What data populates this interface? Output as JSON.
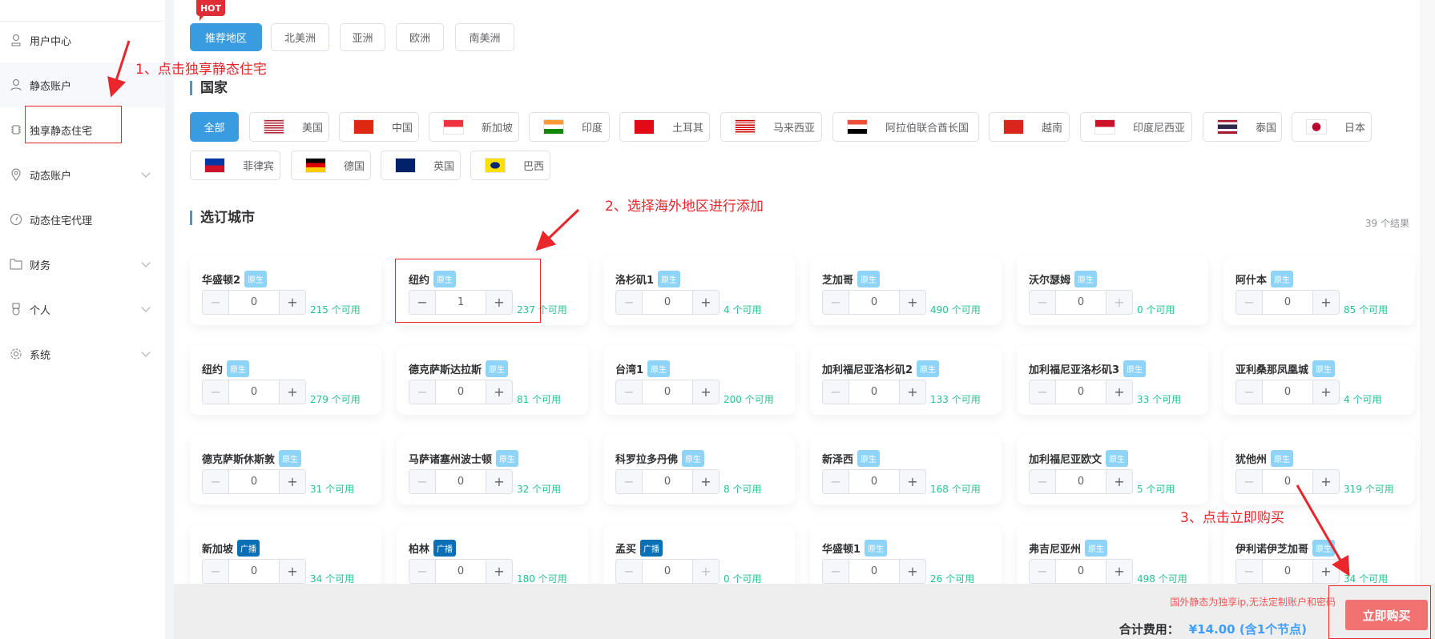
{
  "sidebar": {
    "items": [
      {
        "label": "用户中心",
        "icon": "user-center-icon"
      },
      {
        "label": "静态账户",
        "icon": "user-icon"
      },
      {
        "label": "独享静态住宅",
        "icon": "chip-icon"
      },
      {
        "label": "动态账户",
        "icon": "location-icon",
        "expandable": true
      },
      {
        "label": "动态住宅代理",
        "icon": "gauge-icon"
      },
      {
        "label": "财务",
        "icon": "folder-icon",
        "expandable": true
      },
      {
        "label": "个人",
        "icon": "badge-icon",
        "expandable": true
      },
      {
        "label": "系统",
        "icon": "gear-icon",
        "expandable": true
      }
    ]
  },
  "regions": {
    "hot_label": "HOT",
    "items": [
      "推荐地区",
      "北美洲",
      "亚洲",
      "欧洲",
      "南美洲"
    ],
    "selected": "推荐地区"
  },
  "countries": {
    "heading": "国家",
    "items": [
      {
        "label": "全部"
      },
      {
        "label": "美国",
        "flag": "us"
      },
      {
        "label": "中国",
        "flag": "cn"
      },
      {
        "label": "新加坡",
        "flag": "sg"
      },
      {
        "label": "印度",
        "flag": "in"
      },
      {
        "label": "土耳其",
        "flag": "tr"
      },
      {
        "label": "马来西亚",
        "flag": "my"
      },
      {
        "label": "阿拉伯联合酋长国",
        "flag": "eg"
      },
      {
        "label": "越南",
        "flag": "vn"
      },
      {
        "label": "印度尼西亚",
        "flag": "id"
      },
      {
        "label": "泰国",
        "flag": "th"
      },
      {
        "label": "日本",
        "flag": "jp"
      },
      {
        "label": "菲律宾",
        "flag": "ph"
      },
      {
        "label": "德国",
        "flag": "de"
      },
      {
        "label": "英国",
        "flag": "gb"
      },
      {
        "label": "巴西",
        "flag": "br"
      }
    ],
    "selected": "全部"
  },
  "cities": {
    "heading": "选订城市",
    "result_count": "39 个结果",
    "items": [
      {
        "name": "华盛顿2",
        "type": "原生",
        "qty": "0",
        "available": "215 个可用"
      },
      {
        "name": "纽约",
        "type": "原生",
        "qty": "1",
        "available": "237 个可用"
      },
      {
        "name": "洛杉矶1",
        "type": "原生",
        "qty": "0",
        "available": "4 个可用"
      },
      {
        "name": "芝加哥",
        "type": "原生",
        "qty": "0",
        "available": "490 个可用"
      },
      {
        "name": "沃尔瑟姆",
        "type": "原生",
        "qty": "0",
        "available": "0 个可用"
      },
      {
        "name": "阿什本",
        "type": "原生",
        "qty": "0",
        "available": "85 个可用"
      },
      {
        "name": "纽约",
        "type": "原生",
        "qty": "0",
        "available": "279 个可用"
      },
      {
        "name": "德克萨斯达拉斯",
        "type": "原生",
        "qty": "0",
        "available": "81 个可用"
      },
      {
        "name": "台湾1",
        "type": "原生",
        "qty": "0",
        "available": "200 个可用"
      },
      {
        "name": "加利福尼亚洛杉矶2",
        "type": "原生",
        "qty": "0",
        "available": "133 个可用"
      },
      {
        "name": "加利福尼亚洛杉矶3",
        "type": "原生",
        "qty": "0",
        "available": "33 个可用"
      },
      {
        "name": "亚利桑那凤凰城",
        "type": "原生",
        "qty": "0",
        "available": "4 个可用"
      },
      {
        "name": "德克萨斯休斯敦",
        "type": "原生",
        "qty": "0",
        "available": "31 个可用"
      },
      {
        "name": "马萨诸塞州波士顿",
        "type": "原生",
        "qty": "0",
        "available": "32 个可用"
      },
      {
        "name": "科罗拉多丹佛",
        "type": "原生",
        "qty": "0",
        "available": "8 个可用"
      },
      {
        "name": "新泽西",
        "type": "原生",
        "qty": "0",
        "available": "168 个可用"
      },
      {
        "name": "加利福尼亚欧文",
        "type": "原生",
        "qty": "0",
        "available": "5 个可用"
      },
      {
        "name": "犹他州",
        "type": "原生",
        "qty": "0",
        "available": "319 个可用"
      },
      {
        "name": "新加坡",
        "type": "广播",
        "qty": "0",
        "available": "34 个可用"
      },
      {
        "name": "柏林",
        "type": "广播",
        "qty": "0",
        "available": "180 个可用"
      },
      {
        "name": "孟买",
        "type": "广播",
        "qty": "0",
        "available": "0 个可用"
      },
      {
        "name": "华盛顿1",
        "type": "原生",
        "qty": "0",
        "available": "26 个可用"
      },
      {
        "name": "弗吉尼亚州",
        "type": "原生",
        "qty": "0",
        "available": "498 个可用"
      },
      {
        "name": "伊利诺伊芝加哥",
        "type": "原生",
        "qty": "0",
        "available": "34 个可用"
      }
    ]
  },
  "footer": {
    "notice": "国外静态为独享ip,无法定制账户和密码",
    "total_label": "合计费用：",
    "total_value": "¥14.00 (含1个节点)",
    "buy_label": "立即购买"
  },
  "annotations": {
    "step1": "1、点击独享静态住宅",
    "step2": "2、选择海外地区进行添加",
    "step3": "3、点击立即购买"
  },
  "colors": {
    "primary": "#3a9ce0",
    "available": "#27c28b",
    "badge_native": "#8ed3f8",
    "badge_broadcast": "#0a70b6",
    "buy": "#f27171",
    "annotation": "#e8262b",
    "total": "#409eff"
  }
}
